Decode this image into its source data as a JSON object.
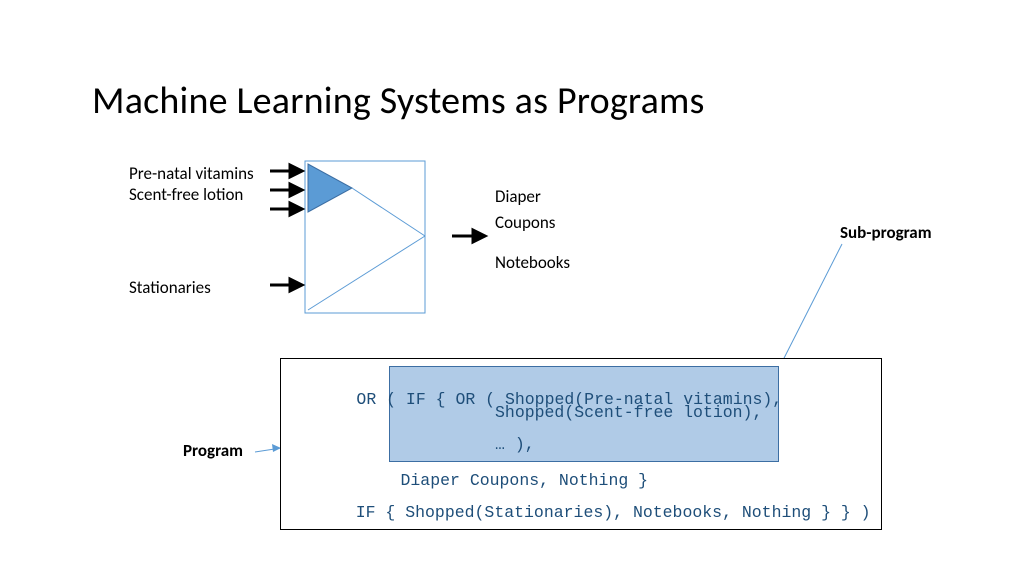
{
  "title": "Machine Learning Systems as Programs",
  "inputs": {
    "top1": "Pre-natal vitamins",
    "top2": "Scent-free lotion",
    "bottom": "Stationaries"
  },
  "outputs": {
    "line1": "Diaper",
    "line2": "Coupons",
    "line3": "Notebooks"
  },
  "labels": {
    "program": "Program",
    "subprogram": "Sub-program"
  },
  "code": {
    "l1a": "OR ( IF { ",
    "l1b": "OR ( Shopped(Pre-natal vitamins),",
    "l2": "          Shopped(Scent-free lotion),",
    "l3": "          … ),",
    "l4": "     Diaper Coupons, Nothing }",
    "l5": "   IF { Shopped(Stationaries), Notebooks, Nothing } } )"
  }
}
